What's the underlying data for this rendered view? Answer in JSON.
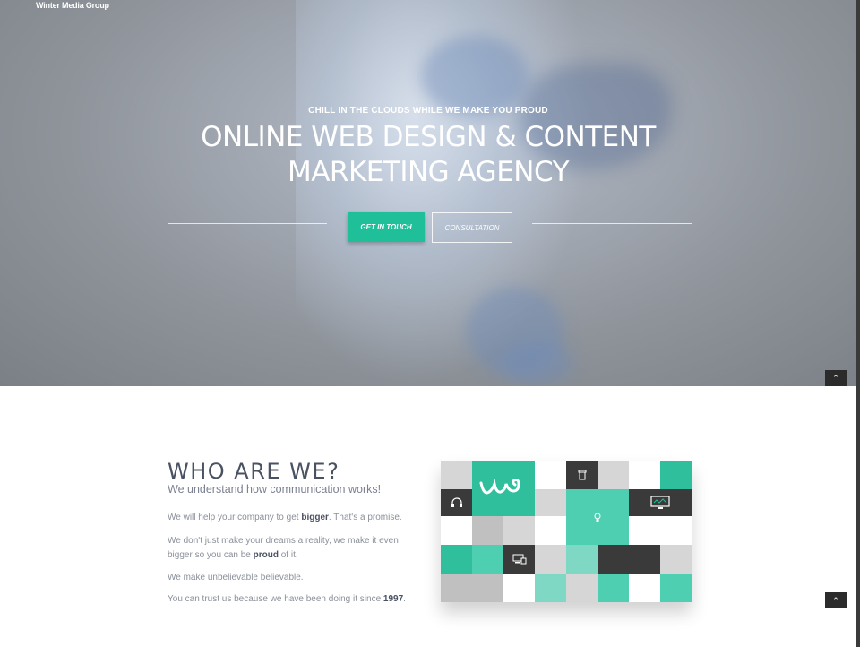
{
  "header": {
    "brand": "Winter Media Group"
  },
  "hero": {
    "tagline": "CHILL IN THE CLOUDS WHILE WE MAKE YOU PROUD",
    "headline_line1": "ONLINE WEB DESIGN & CONTENT",
    "headline_line2": "MARKETING AGENCY",
    "primary_button": "GET IN TOUCH",
    "secondary_button": "CONSULTATION"
  },
  "scroll_top": {
    "icon": "chevron-up-icon",
    "glyph": "⌃"
  },
  "about": {
    "title": "WHO ARE WE?",
    "subtitle": "We understand how communication works!",
    "p1": {
      "before": "We will help your company to get ",
      "bold": "bigger",
      "after": ". That's a promise."
    },
    "p2": {
      "before": "We don't just make your dreams a reality, we make it even bigger so you can be ",
      "bold": "proud",
      "after": " of it."
    },
    "p3": "We make unbelievable believable.",
    "p4": {
      "before": "You can trust us because we have been doing it since ",
      "bold": "1997",
      "after": "."
    }
  },
  "colors": {
    "accent": "#1fbf9a",
    "teal_light": "#7fd8c4",
    "dark": "#3a3a3a",
    "grey": "#d8d8d8",
    "text": "#4a5161"
  },
  "mosaic": {
    "icons": [
      "logo-icon",
      "trash-icon",
      "headset-icon",
      "monitor-icon",
      "lightbulb-icon",
      "devices-icon"
    ]
  }
}
